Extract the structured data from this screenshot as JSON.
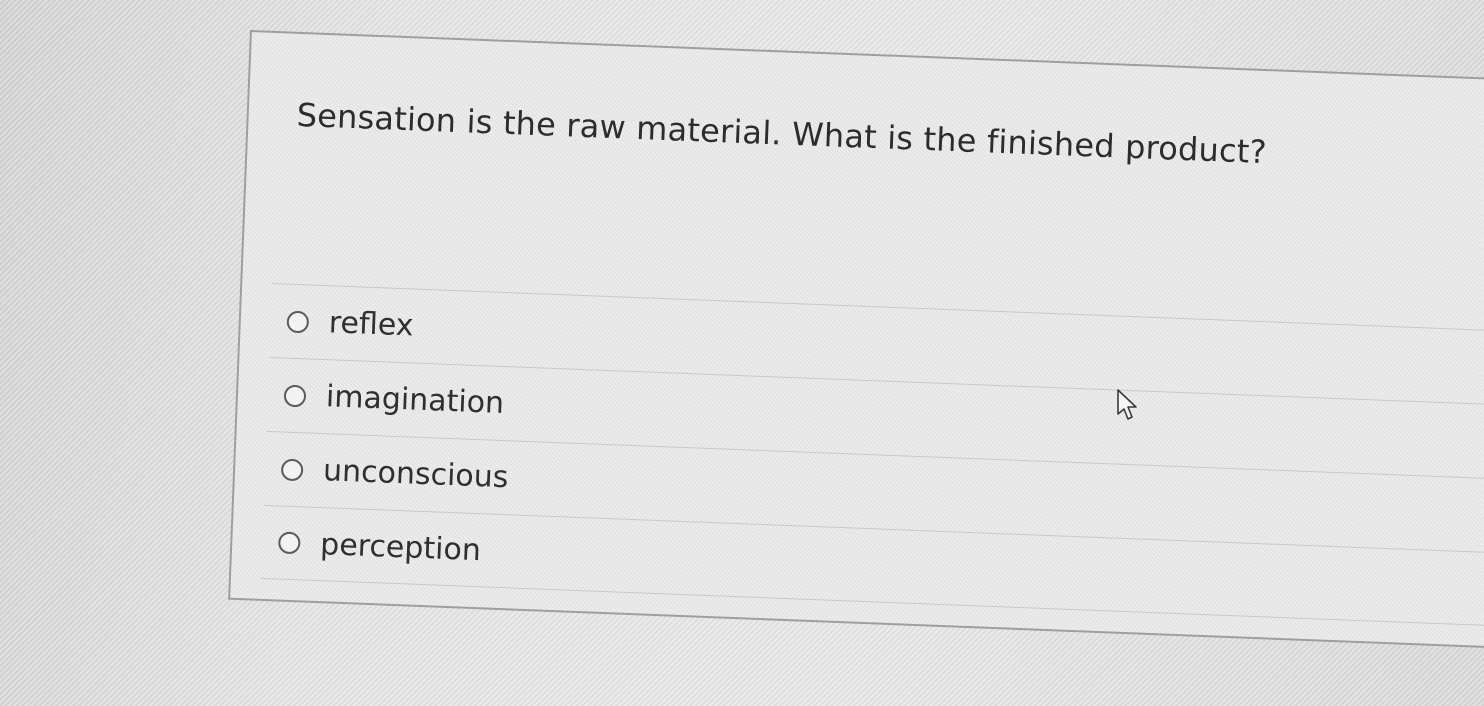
{
  "quiz": {
    "question": "Sensation is the raw material.  What is the finished product?",
    "options": [
      {
        "label": "reflex",
        "selected": false
      },
      {
        "label": "imagination",
        "selected": false
      },
      {
        "label": "unconscious",
        "selected": false
      },
      {
        "label": "perception",
        "selected": false
      }
    ]
  },
  "icons": {
    "cursor": "mouse-pointer-icon",
    "radio": "radio-unchecked-icon"
  },
  "colors": {
    "text": "#2c2c2c",
    "border": "#9e9e9e"
  }
}
